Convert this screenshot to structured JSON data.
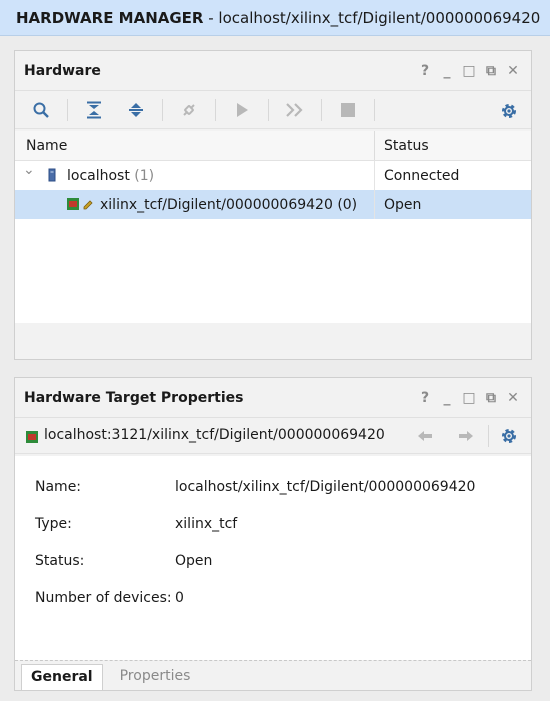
{
  "titlebar": {
    "title": "HARDWARE MANAGER",
    "subtitle": " - localhost/xilinx_tcf/Digilent/000000069420"
  },
  "hardware_panel": {
    "title": "Hardware",
    "window_controls": [
      "?",
      "_",
      "□",
      "⧉",
      "✕"
    ],
    "toolbar": {
      "buttons": [
        "search-icon",
        "collapse-all-icon",
        "expand-all-icon",
        "auto-connect-icon",
        "run-icon",
        "fast-forward-icon",
        "stop-icon"
      ],
      "settings": "gear-icon"
    },
    "columns": {
      "name": "Name",
      "status": "Status"
    },
    "rows": [
      {
        "name": "localhost",
        "count": "(1)",
        "status": "Connected",
        "expander": "⌄"
      },
      {
        "name": "xilinx_tcf/Digilent/000000069420",
        "count": "(0)",
        "status": "Open"
      }
    ]
  },
  "target_panel": {
    "title": "Hardware Target Properties",
    "window_controls": [
      "?",
      "_",
      "□",
      "⧉",
      "✕"
    ],
    "path": "localhost:3121/xilinx_tcf/Digilent/000000069420",
    "properties": [
      {
        "label": "Name:",
        "value": "localhost/xilinx_tcf/Digilent/000000069420"
      },
      {
        "label": "Type:",
        "value": "xilinx_tcf"
      },
      {
        "label": "Status:",
        "value": "Open"
      },
      {
        "label": "Number of devices:",
        "value": "0"
      }
    ],
    "tabs": [
      {
        "label": "General",
        "active": true
      },
      {
        "label": "Properties",
        "active": false
      }
    ]
  },
  "colors": {
    "accent": "#3a6ea5",
    "titlebar_bg": "#cfe3fa",
    "selection": "#cbe0f7",
    "chip_green": "#2e8b3a",
    "chip_red": "#c0392b"
  }
}
